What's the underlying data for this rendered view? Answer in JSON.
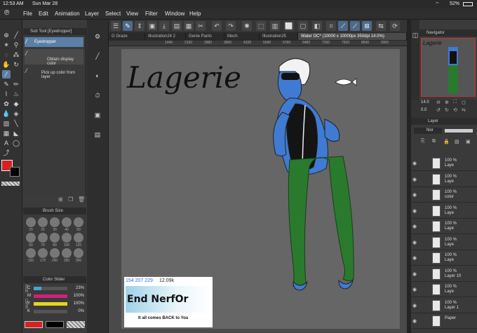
{
  "status": {
    "time": "12:53 AM",
    "date": "Sun Mar 28",
    "battery": "52%"
  },
  "menu": [
    "File",
    "Edit",
    "Animation",
    "Layer",
    "Select",
    "View",
    "Filter",
    "Window",
    "Help"
  ],
  "subtool": {
    "title": "Sub Tool [Eyedropper]",
    "items": [
      "Eyedropper",
      "Obtain display color",
      "Pick up color from layer"
    ]
  },
  "brush_size": {
    "title": "Brush Size",
    "sizes": [
      "20",
      "25",
      "30",
      "40",
      "50",
      "60",
      "70",
      "80",
      "100",
      "120",
      "150",
      "170",
      "200",
      "250",
      "300"
    ]
  },
  "color_slider": {
    "title": "Color Slider",
    "labels": [
      "C",
      "M",
      "Y",
      "K"
    ],
    "values": [
      "23%",
      "100%",
      "100%",
      "0%"
    ],
    "fractions": [
      0.23,
      1.0,
      1.0,
      0.0
    ],
    "bar_colors": [
      "#3fa9c9",
      "#d0207a",
      "#e8d41f",
      "#444444"
    ],
    "group_labels": [
      "RGB",
      "CMYK"
    ]
  },
  "tabs": [
    "G Graze",
    "Illustration24 2",
    "Genie Pants",
    "Mech",
    "Illustration25",
    "Water OC* (10000 x 10000px 350dpi 14.0%)"
  ],
  "ruler_ticks": [
    "1440",
    "2160",
    "2880",
    "3600",
    "4320",
    "5040",
    "5760",
    "6480",
    "7200",
    "7920",
    "8640",
    "9360"
  ],
  "canvas": {
    "handwritten_title": "Lagerie",
    "watermark": {
      "numbers": "154 207 229",
      "followers": "12.09k",
      "logo": "End NerfOr",
      "tagline": "It all comes BACK to You"
    }
  },
  "navigator": {
    "title": "Navigator",
    "zoom": "14.0",
    "angle": "0.0",
    "thumb_text": "Lagerie"
  },
  "layer_panel": {
    "title": "Layer",
    "blend": "Nor",
    "layers": [
      {
        "pct": "100 %",
        "name": "Laye"
      },
      {
        "pct": "100 %",
        "name": "Laye"
      },
      {
        "pct": "100 %",
        "name": "color"
      },
      {
        "pct": "100 %",
        "name": "Laye"
      },
      {
        "pct": "100 %",
        "name": "Laye"
      },
      {
        "pct": "100 %",
        "name": "Laye"
      },
      {
        "pct": "100 %",
        "name": "Laye"
      },
      {
        "pct": "100 %",
        "name": "Layer 10"
      },
      {
        "pct": "100 %",
        "name": "Laye"
      },
      {
        "pct": "100 %",
        "name": "Layer 1"
      },
      {
        "pct": "",
        "name": "Paper"
      }
    ]
  },
  "colors": {
    "main": "#d42222",
    "sub": "#000000",
    "ui_accent": "#5b7fa7"
  }
}
